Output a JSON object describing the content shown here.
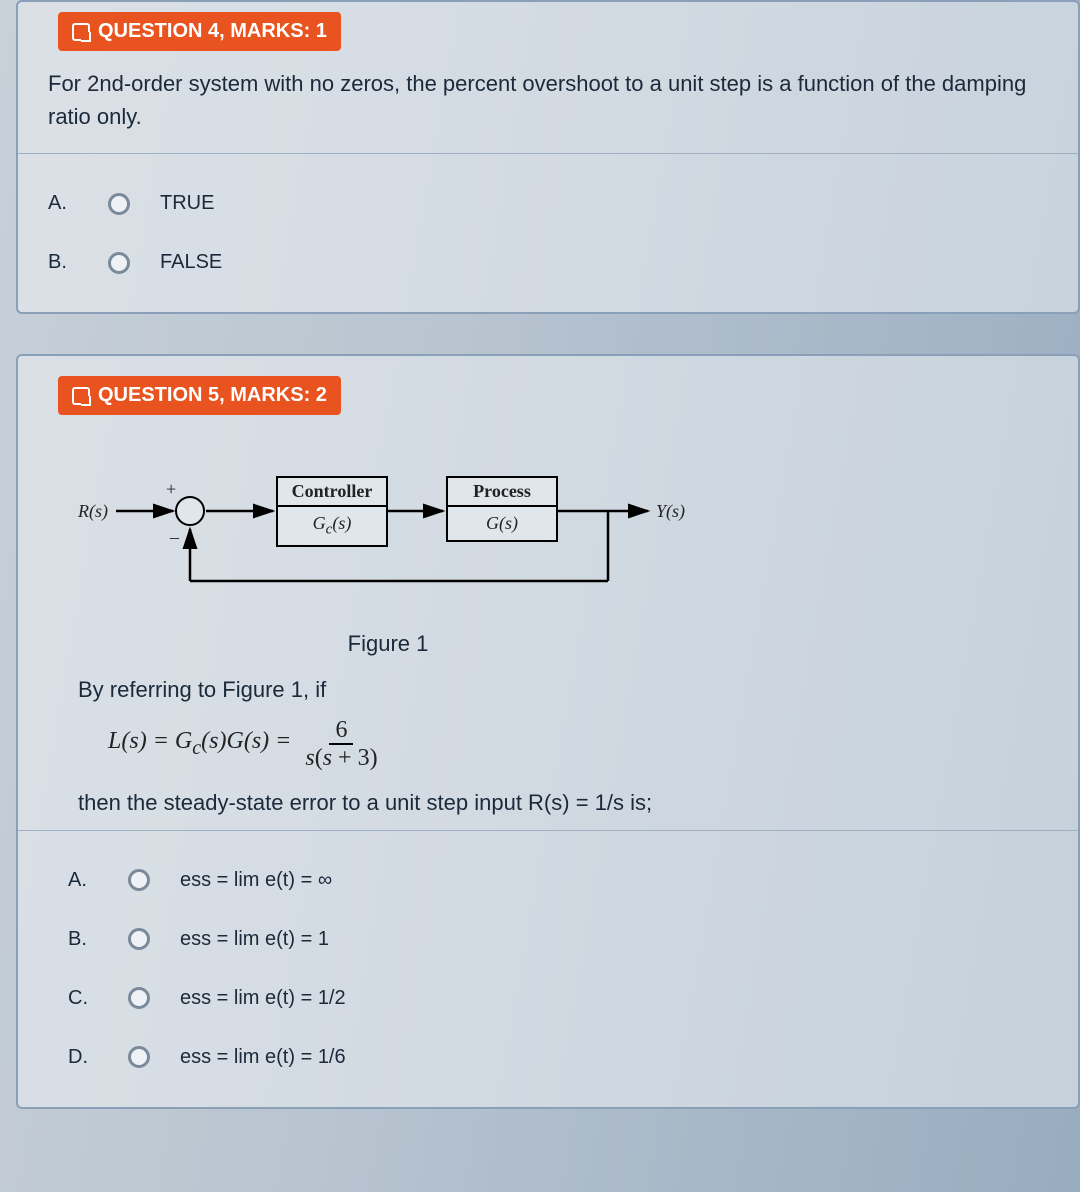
{
  "question4": {
    "badge": "QUESTION 4, MARKS: 1",
    "text": "For 2nd-order system with no zeros, the percent overshoot to a unit step is a function of the damping ratio only.",
    "options": {
      "A": {
        "letter": "A.",
        "label": "TRUE"
      },
      "B": {
        "letter": "B.",
        "label": "FALSE"
      }
    }
  },
  "question5": {
    "badge": "QUESTION 5, MARKS: 2",
    "diagram": {
      "input": "R(s)",
      "controller_header": "Controller",
      "controller_body": "G₋(s)",
      "controller_tf": "Gc(s)",
      "process_header": "Process",
      "process_body": "G(s)",
      "output": "Y(s)",
      "plus": "+",
      "minus": "–"
    },
    "figure_caption": "Figure 1",
    "intro": "By referring to Figure 1, if",
    "formula_lhs": "L(s) = G_c(s)G(s) =",
    "formula_num": "6",
    "formula_den": "s(s + 3)",
    "followup": "then the steady-state error to a unit step input R(s) = 1/s is;",
    "options": {
      "A": {
        "letter": "A.",
        "label": "ess = lim e(t) = ∞"
      },
      "B": {
        "letter": "B.",
        "label": "ess = lim e(t) = 1"
      },
      "C": {
        "letter": "C.",
        "label": "ess = lim e(t) = 1/2"
      },
      "D": {
        "letter": "D.",
        "label": "ess = lim e(t) = 1/6"
      }
    }
  }
}
